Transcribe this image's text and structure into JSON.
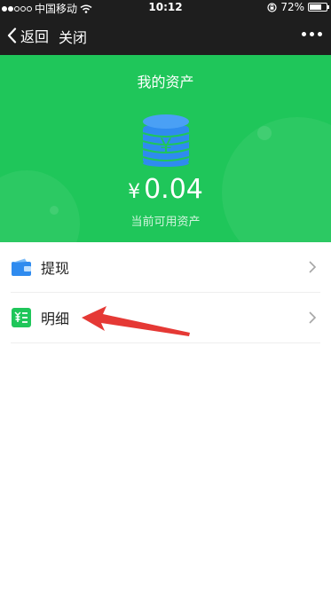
{
  "statusbar": {
    "carrier": "中国移动",
    "time": "10:12",
    "battery": "72%",
    "battery_level": 0.72
  },
  "nav": {
    "back_label": "返回",
    "close_label": "关闭"
  },
  "hero": {
    "title": "我的资产",
    "currency_symbol": "¥",
    "amount": "0.04",
    "subtitle": "当前可用资产",
    "color": "#1fc65a",
    "coin_color": "#2f8bef"
  },
  "menu": [
    {
      "label": "提现",
      "icon": "wallet-icon"
    },
    {
      "label": "明细",
      "icon": "list-detail-icon"
    }
  ],
  "annotation": {
    "arrow_color": "#e53935"
  }
}
